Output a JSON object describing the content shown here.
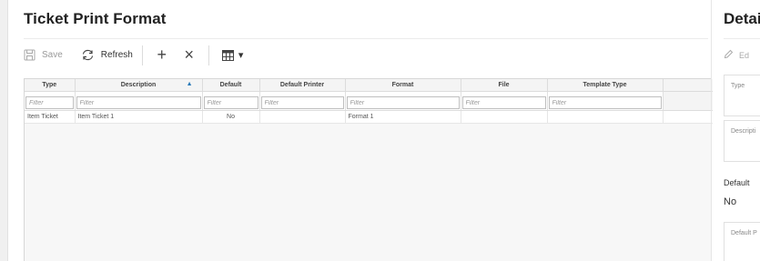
{
  "left_panel": {
    "title": "Ticket Print Format",
    "toolbar": {
      "save_label": "Save",
      "refresh_label": "Refresh",
      "add_glyph": "+",
      "delete_glyph": "×",
      "grid_menu_glyph": "▾"
    },
    "grid": {
      "columns": [
        "Type",
        "Description",
        "Default",
        "Default Printer",
        "Format",
        "File",
        "Template Type"
      ],
      "sorted_column": "Description",
      "sort_direction": "ascending",
      "filter_placeholder": "Filter",
      "rows": [
        [
          "Item Ticket",
          "Item Ticket 1",
          "No",
          "",
          "Format 1",
          "",
          ""
        ]
      ]
    }
  },
  "detail_panel": {
    "title": "Detai",
    "edit_label": "Ed",
    "fields": {
      "type_label": "Type",
      "description_label": "Descripti",
      "default_label": "Default",
      "default_value": "No",
      "default_printer_label": "Default P"
    }
  },
  "colors": {
    "accent": "#2a7ab9",
    "border": "#d7d7d7",
    "disabled": "#9a9a9a"
  },
  "icons": {
    "save": "save-icon",
    "refresh": "refresh-icon",
    "add": "plus-icon",
    "delete": "close-icon",
    "grid": "grid-view-icon",
    "dropdown": "caret-down-icon",
    "edit": "pencil-icon"
  }
}
